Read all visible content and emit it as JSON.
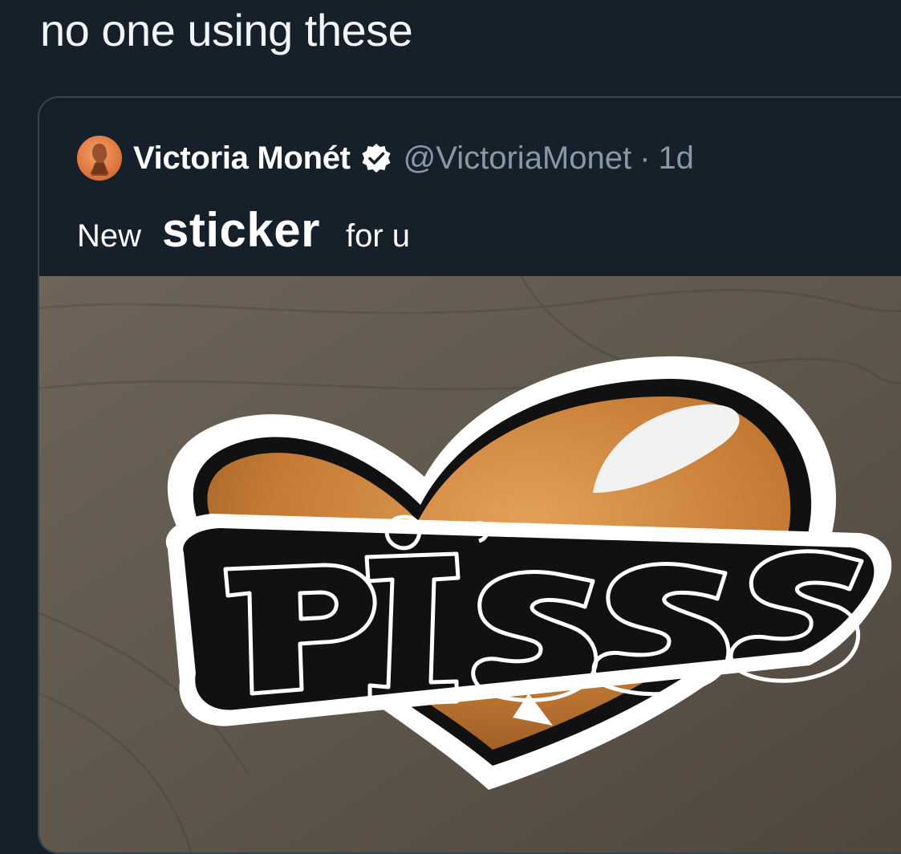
{
  "tweet": {
    "text": "no one using these"
  },
  "quoted_tweet": {
    "display_name": "Victoria Monét",
    "handle": "@VictoriaMonet",
    "separator": "·",
    "timestamp": "1d",
    "body": {
      "before": "New",
      "sticker_word": "sticker",
      "after": "for u"
    },
    "media": {
      "sticker_text": "PISS"
    }
  },
  "icons": {
    "verified": "verified-badge-icon",
    "avatar": "avatar"
  },
  "colors": {
    "background": "#15202b",
    "border": "#38444d",
    "secondary_text": "#8899a6",
    "sticker_orange": "#c47a34"
  }
}
